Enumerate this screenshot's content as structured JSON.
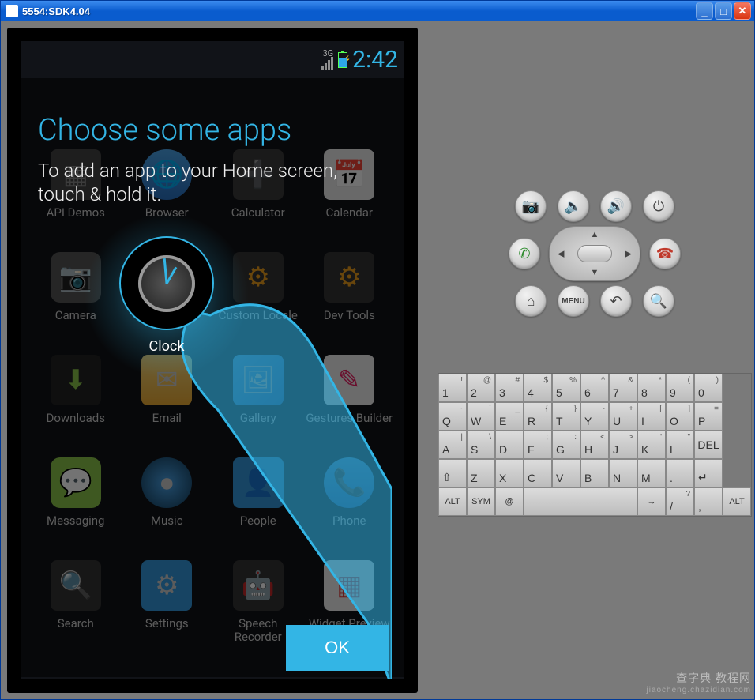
{
  "window": {
    "title": "5554:SDK4.04"
  },
  "statusbar": {
    "network": "3G",
    "time": "2:42"
  },
  "tutorial": {
    "title": "Choose some apps",
    "body": "To add an app to your Home screen, touch & hold it.",
    "ok": "OK",
    "highlighted_app": "Clock"
  },
  "apps": [
    {
      "label": "API Demos",
      "icon": "ic-api"
    },
    {
      "label": "Browser",
      "icon": "ic-browser"
    },
    {
      "label": "Calculator",
      "icon": "ic-calc"
    },
    {
      "label": "Calendar",
      "icon": "ic-cal"
    },
    {
      "label": "Camera",
      "icon": "ic-cam"
    },
    {
      "label": "Clock",
      "icon": "ic-clock"
    },
    {
      "label": "Custom Locale",
      "icon": "ic-locale"
    },
    {
      "label": "Dev Tools",
      "icon": "ic-dev"
    },
    {
      "label": "Downloads",
      "icon": "ic-dl"
    },
    {
      "label": "Email",
      "icon": "ic-email"
    },
    {
      "label": "Gallery",
      "icon": "ic-gallery"
    },
    {
      "label": "Gestures Builder",
      "icon": "ic-gesture"
    },
    {
      "label": "Messaging",
      "icon": "ic-msg"
    },
    {
      "label": "Music",
      "icon": "ic-music"
    },
    {
      "label": "People",
      "icon": "ic-people"
    },
    {
      "label": "Phone",
      "icon": "ic-phone"
    },
    {
      "label": "Search",
      "icon": "ic-search"
    },
    {
      "label": "Settings",
      "icon": "ic-settings"
    },
    {
      "label": "Speech Recorder",
      "icon": "ic-speech"
    },
    {
      "label": "Widget Preview",
      "icon": "ic-widget"
    }
  ],
  "hw_buttons": {
    "camera": "camera",
    "vol_down": "vol-",
    "vol_up": "vol+",
    "power": "power",
    "call": "call",
    "end": "end",
    "home": "home",
    "menu": "MENU",
    "back": "back",
    "search": "search"
  },
  "keyboard": {
    "row1": [
      {
        "m": "1",
        "s": "!"
      },
      {
        "m": "2",
        "s": "@"
      },
      {
        "m": "3",
        "s": "#"
      },
      {
        "m": "4",
        "s": "$"
      },
      {
        "m": "5",
        "s": "%"
      },
      {
        "m": "6",
        "s": "^"
      },
      {
        "m": "7",
        "s": "&"
      },
      {
        "m": "8",
        "s": "*"
      },
      {
        "m": "9",
        "s": "("
      },
      {
        "m": "0",
        "s": ")"
      }
    ],
    "row2": [
      {
        "m": "Q",
        "s": "~"
      },
      {
        "m": "W",
        "s": "`"
      },
      {
        "m": "E",
        "s": "_"
      },
      {
        "m": "R",
        "s": "{"
      },
      {
        "m": "T",
        "s": "}"
      },
      {
        "m": "Y",
        "s": "-"
      },
      {
        "m": "U",
        "s": "+"
      },
      {
        "m": "I",
        "s": "["
      },
      {
        "m": "O",
        "s": "]"
      },
      {
        "m": "P",
        "s": "="
      }
    ],
    "row3": [
      {
        "m": "A",
        "s": "|"
      },
      {
        "m": "S",
        "s": "\\"
      },
      {
        "m": "D",
        "s": ""
      },
      {
        "m": "F",
        "s": ";"
      },
      {
        "m": "G",
        "s": ":"
      },
      {
        "m": "H",
        "s": "<"
      },
      {
        "m": "J",
        "s": ">"
      },
      {
        "m": "K",
        "s": "'"
      },
      {
        "m": "L",
        "s": "\""
      },
      {
        "m": "DEL",
        "s": "",
        "del": true
      }
    ],
    "row4": [
      {
        "m": "⇧",
        "s": ""
      },
      {
        "m": "Z",
        "s": ""
      },
      {
        "m": "X",
        "s": ""
      },
      {
        "m": "C",
        "s": ""
      },
      {
        "m": "V",
        "s": ""
      },
      {
        "m": "B",
        "s": ""
      },
      {
        "m": "N",
        "s": ""
      },
      {
        "m": "M",
        "s": ""
      },
      {
        "m": ".",
        "s": ""
      },
      {
        "m": "↵",
        "s": ""
      }
    ],
    "row5_alt": "ALT",
    "row5_sym": "SYM",
    "row5_at": "@",
    "row5_space": "⎵",
    "row5_right": "→",
    "row5_slash": "/",
    "row5_comma": ",",
    "row5_q": "?",
    "row5_alt2": "ALT"
  },
  "watermark": {
    "main": "查字典 教程网",
    "sub": "jiaocheng.chazidian.com"
  }
}
